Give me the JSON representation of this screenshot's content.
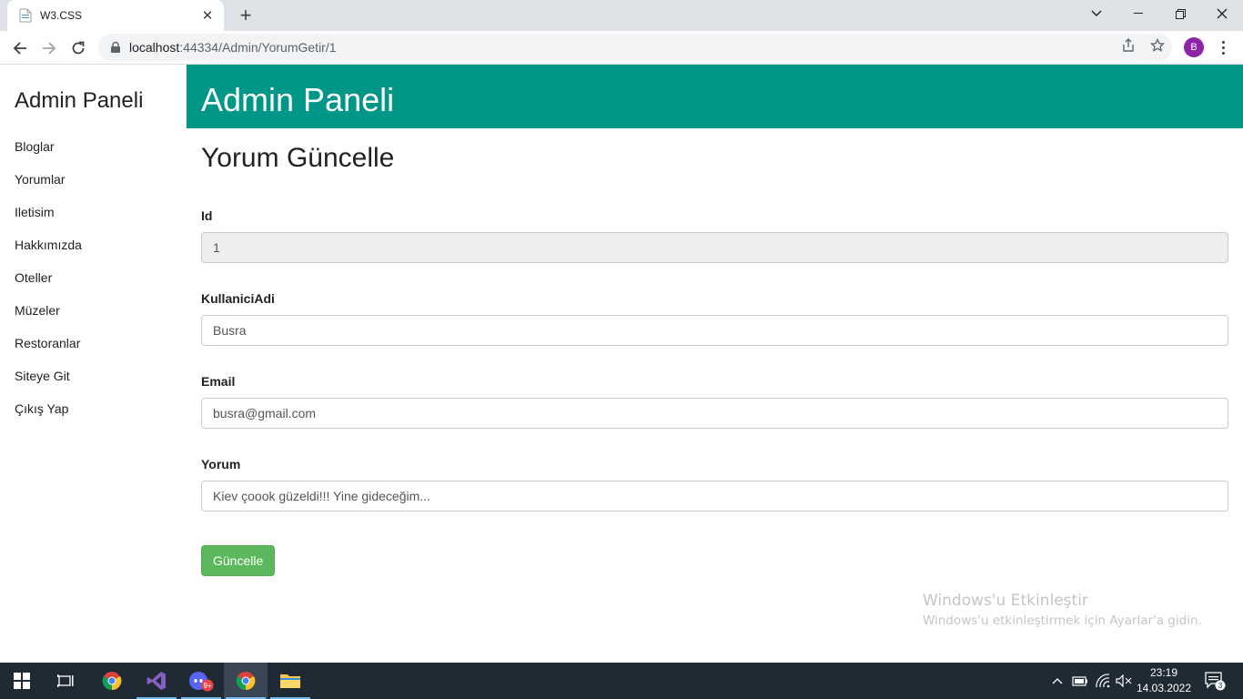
{
  "browser": {
    "tab_title": "W3.CSS",
    "url_host": "localhost",
    "url_path": ":44334/Admin/YorumGetir/1",
    "profile_initial": "B"
  },
  "sidebar": {
    "title": "Admin Paneli",
    "items": [
      {
        "label": "Bloglar"
      },
      {
        "label": "Yorumlar"
      },
      {
        "label": "Iletisim"
      },
      {
        "label": "Hakkımızda"
      },
      {
        "label": "Oteller"
      },
      {
        "label": "Müzeler"
      },
      {
        "label": "Restoranlar"
      },
      {
        "label": "Siteye Git"
      },
      {
        "label": "Çıkış Yap"
      }
    ]
  },
  "header": {
    "title": "Admin Paneli"
  },
  "form": {
    "title": "Yorum Güncelle",
    "fields": [
      {
        "label": "Id",
        "value": "1"
      },
      {
        "label": "KullaniciAdi",
        "value": "Busra"
      },
      {
        "label": "Email",
        "value": "busra@gmail.com"
      },
      {
        "label": "Yorum",
        "value": "Kiev çoook güzeldi!!! Yine gideceğim..."
      }
    ],
    "submit_label": "Güncelle"
  },
  "watermark": {
    "title": "Windows'u Etkinleştir",
    "subtitle": "Windows'u etkinleştirmek için Ayarlar'a gidin."
  },
  "taskbar": {
    "time": "23:19",
    "date": "14.03.2022",
    "notification_count": "3",
    "discord_badge": "9+"
  },
  "colors": {
    "header_bg": "#009688",
    "button_bg": "#5cb85c",
    "taskbar_bg": "#1f2a35",
    "profile_bg": "#8e24aa"
  }
}
